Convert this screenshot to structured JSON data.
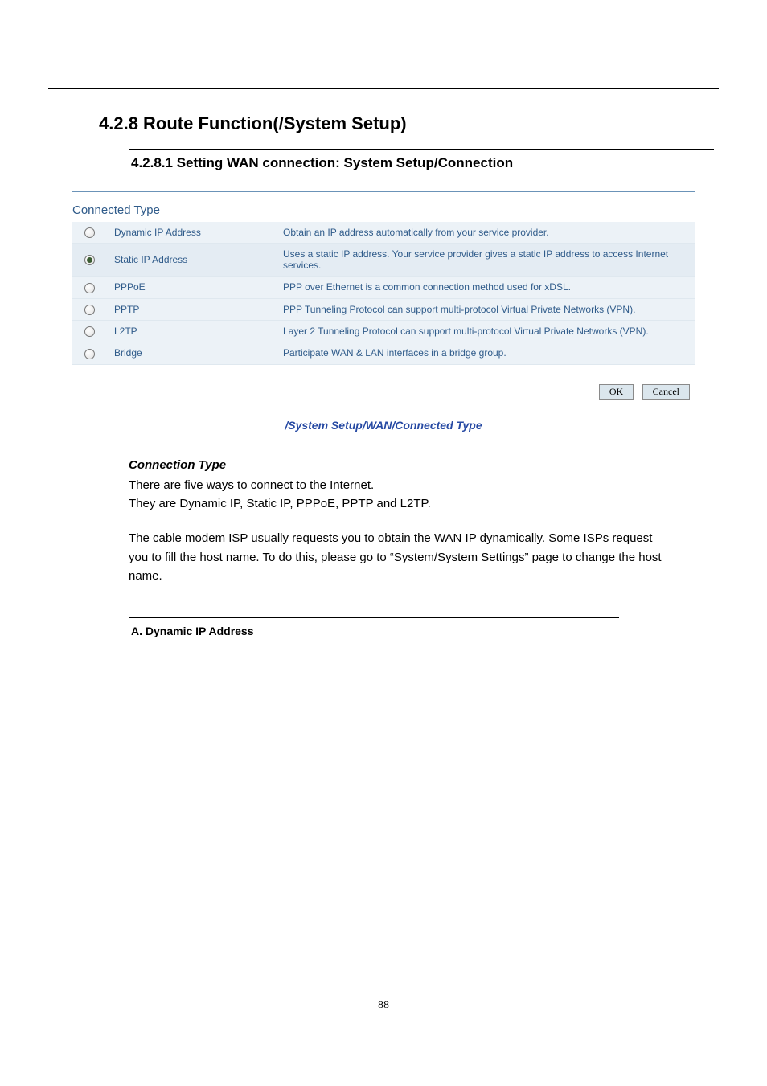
{
  "headings": {
    "h1": "4.2.8  Route Function(/System Setup)",
    "h2": "4.2.8.1  Setting WAN connection: System Setup/Connection",
    "panel_title": "Connected Type",
    "caption": "/System Setup/WAN/Connected Type",
    "sub_a": "A. Dynamic IP Address"
  },
  "rows": [
    {
      "checked": false,
      "name": "Dynamic IP Address",
      "desc": "Obtain an IP address automatically from your service provider."
    },
    {
      "checked": true,
      "name": "Static IP Address",
      "desc": "Uses a static IP address. Your service provider gives a static IP address to access Internet services."
    },
    {
      "checked": false,
      "name": "PPPoE",
      "desc": "PPP over Ethernet is a common connection method used for xDSL."
    },
    {
      "checked": false,
      "name": "PPTP",
      "desc": "PPP Tunneling Protocol can support multi-protocol Virtual Private Networks (VPN)."
    },
    {
      "checked": false,
      "name": "L2TP",
      "desc": "Layer 2 Tunneling Protocol can support multi-protocol Virtual Private Networks (VPN)."
    },
    {
      "checked": false,
      "name": "Bridge",
      "desc": "Participate WAN & LAN interfaces in a bridge group."
    }
  ],
  "buttons": {
    "ok": "OK",
    "cancel": "Cancel"
  },
  "body": {
    "subhead": "Connection Type",
    "p1": "There are five ways to connect to the Internet.",
    "p2": "They are Dynamic IP, Static IP, PPPoE, PPTP and L2TP.",
    "p3": "The cable modem ISP usually requests you to obtain the WAN IP dynamically.   Some ISPs request you to fill the host name.   To do this, please go to “System/System Settings” page to change the host name."
  },
  "pagenum": "88"
}
